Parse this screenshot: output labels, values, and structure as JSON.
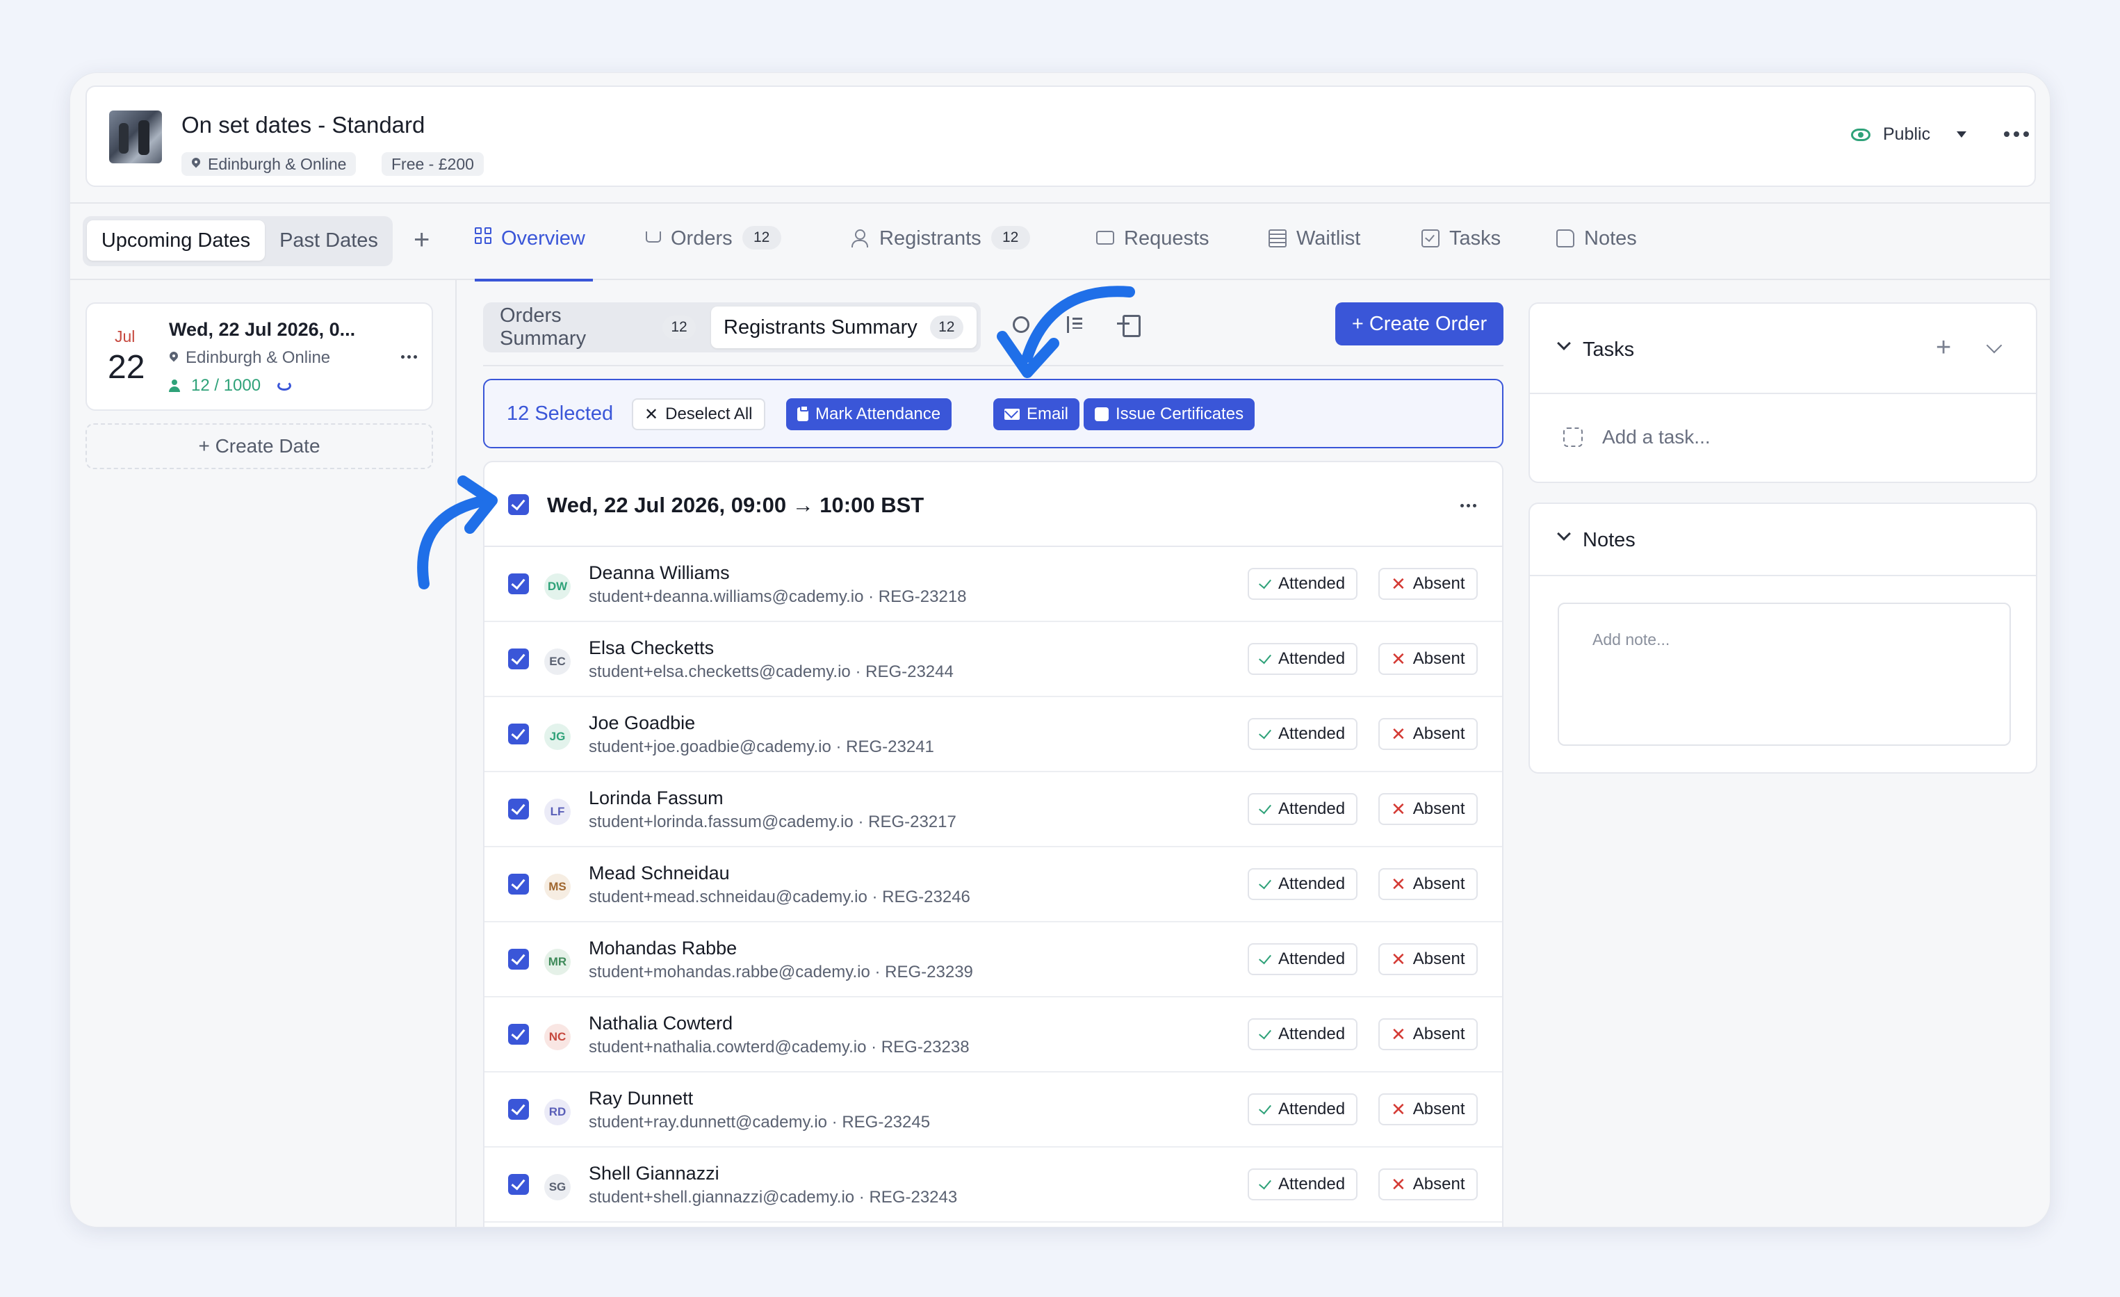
{
  "event": {
    "title": "On set dates - Standard",
    "location": "Edinburgh & Online",
    "price": "Free - £200",
    "visibility": "Public"
  },
  "date_toggle": {
    "upcoming": "Upcoming Dates",
    "past": "Past Dates"
  },
  "tabs": [
    {
      "label": "Overview",
      "icon": "grid-icon",
      "active": true
    },
    {
      "label": "Orders",
      "icon": "cart-icon",
      "badge": "12"
    },
    {
      "label": "Registrants",
      "icon": "user-check-icon",
      "badge": "12"
    },
    {
      "label": "Requests",
      "icon": "inbox-icon"
    },
    {
      "label": "Waitlist",
      "icon": "list-icon"
    },
    {
      "label": "Tasks",
      "icon": "checkbox-icon"
    },
    {
      "label": "Notes",
      "icon": "note-icon"
    }
  ],
  "date_card": {
    "month": "Jul",
    "day": "22",
    "title": "Wed, 22 Jul 2026, 0...",
    "location": "Edinburgh & Online",
    "capacity": "12 / 1000"
  },
  "create_date": "+ Create Date",
  "summary_tabs": {
    "orders": {
      "label": "Orders Summary",
      "count": "12"
    },
    "registrants": {
      "label": "Registrants Summary",
      "count": "12"
    }
  },
  "create_order": "+ Create Order",
  "selection": {
    "count_label": "12 Selected",
    "deselect": "Deselect All",
    "mark_attendance": "Mark Attendance",
    "email": "Email",
    "issue_certificates": "Issue Certificates"
  },
  "session": {
    "title": "Wed, 22 Jul 2026, 09:00 → 10:00 BST"
  },
  "attendance_labels": {
    "attended": "Attended",
    "absent": "Absent"
  },
  "registrants": [
    {
      "initials": "DW",
      "name": "Deanna Williams",
      "meta": "student+deanna.williams@cademy.io · REG-23218",
      "color": "#2fa279",
      "bg": "#e3f3ec"
    },
    {
      "initials": "EC",
      "name": "Elsa Checketts",
      "meta": "student+elsa.checketts@cademy.io · REG-23244",
      "color": "#5a6171",
      "bg": "#eceef2"
    },
    {
      "initials": "JG",
      "name": "Joe Goadbie",
      "meta": "student+joe.goadbie@cademy.io · REG-23241",
      "color": "#2fa279",
      "bg": "#e3f3ec"
    },
    {
      "initials": "LF",
      "name": "Lorinda Fassum",
      "meta": "student+lorinda.fassum@cademy.io · REG-23217",
      "color": "#5a5fb8",
      "bg": "#ebebf7"
    },
    {
      "initials": "MS",
      "name": "Mead Schneidau",
      "meta": "student+mead.schneidau@cademy.io · REG-23246",
      "color": "#a0672f",
      "bg": "#f6ede2"
    },
    {
      "initials": "MR",
      "name": "Mohandas Rabbe",
      "meta": "student+mohandas.rabbe@cademy.io · REG-23239",
      "color": "#3f8a5a",
      "bg": "#e5f1e8"
    },
    {
      "initials": "NC",
      "name": "Nathalia Cowterd",
      "meta": "student+nathalia.cowterd@cademy.io · REG-23238",
      "color": "#c6483e",
      "bg": "#f9e6e3"
    },
    {
      "initials": "RD",
      "name": "Ray Dunnett",
      "meta": "student+ray.dunnett@cademy.io · REG-23245",
      "color": "#5a5fb8",
      "bg": "#ebebf7"
    },
    {
      "initials": "SG",
      "name": "Shell Giannazzi",
      "meta": "student+shell.giannazzi@cademy.io · REG-23243",
      "color": "#5a6171",
      "bg": "#eceef2"
    }
  ],
  "tasks_panel": {
    "title": "Tasks",
    "add_task_placeholder": "Add a task..."
  },
  "notes_panel": {
    "title": "Notes",
    "note_placeholder": "Add note..."
  },
  "colors": {
    "accent": "#3a56d8",
    "success": "#2fa279",
    "danger": "#d43a34",
    "annotation_arrow": "#1f6fe8"
  }
}
